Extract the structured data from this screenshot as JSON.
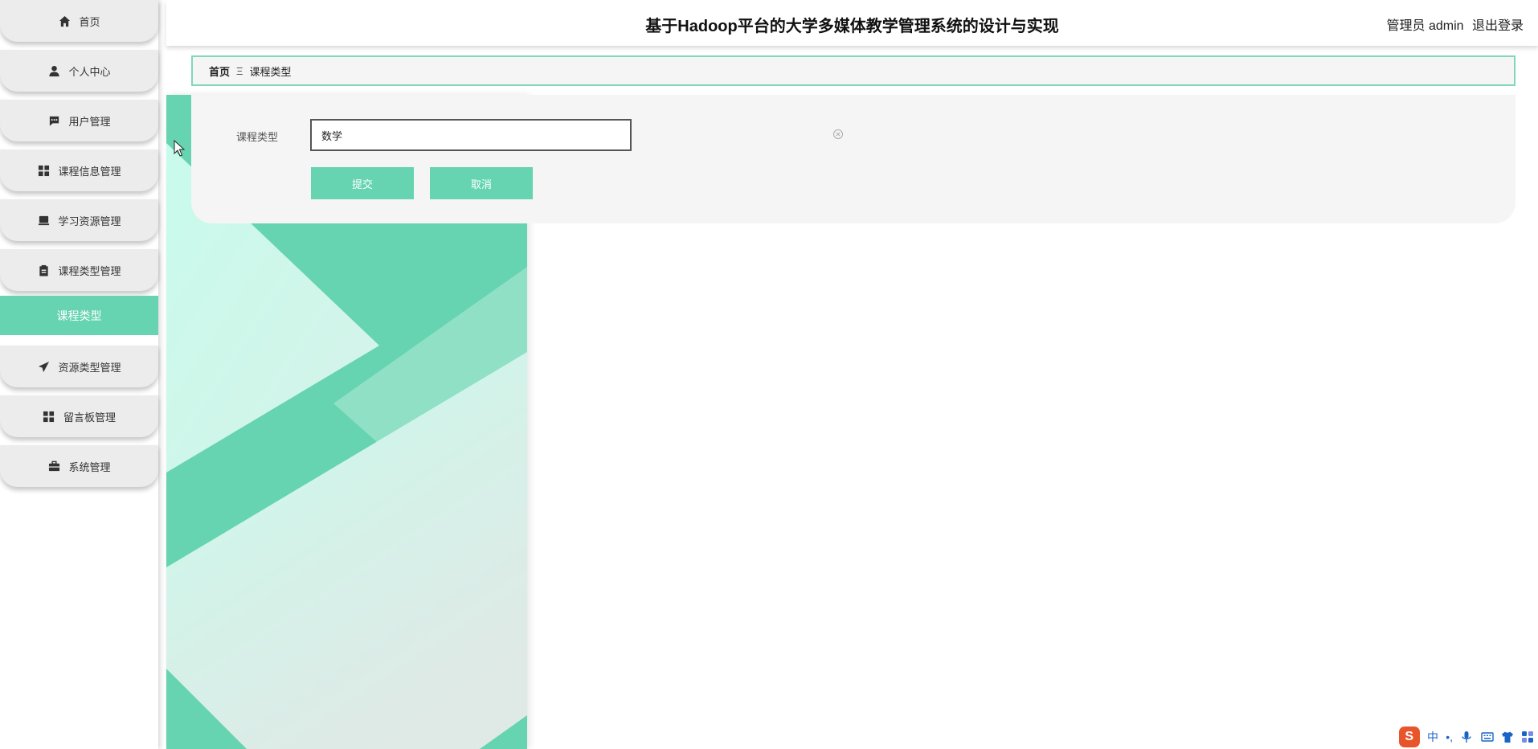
{
  "app": {
    "title": "基于Hadoop平台的大学多媒体教学管理系统的设计与实现",
    "user_role": "管理员 admin",
    "logout": "退出登录"
  },
  "sidebar": {
    "items": [
      {
        "label": "首页",
        "icon": "home-icon"
      },
      {
        "label": "个人中心",
        "icon": "user-icon"
      },
      {
        "label": "用户管理",
        "icon": "chat-icon"
      },
      {
        "label": "课程信息管理",
        "icon": "grid-icon"
      },
      {
        "label": "学习资源管理",
        "icon": "monitor-icon"
      },
      {
        "label": "课程类型管理",
        "icon": "clipboard-icon"
      },
      {
        "label": "课程类型",
        "active": true
      },
      {
        "label": "资源类型管理",
        "icon": "send-icon"
      },
      {
        "label": "留言板管理",
        "icon": "grid-icon"
      },
      {
        "label": "系统管理",
        "icon": "briefcase-icon"
      }
    ]
  },
  "breadcrumb": {
    "home": "首页",
    "separator": "Ξ",
    "current": "课程类型"
  },
  "form": {
    "field_label": "课程类型",
    "field_value": "数学",
    "submit": "提交",
    "cancel": "取消"
  },
  "ime": {
    "logo": "S",
    "mode": "中",
    "punct": "•,"
  },
  "colors": {
    "accent": "#66d4b0",
    "accent_light": "#c8fbeb",
    "panel": "#f6f5f5",
    "ime_logo": "#e8552a"
  }
}
